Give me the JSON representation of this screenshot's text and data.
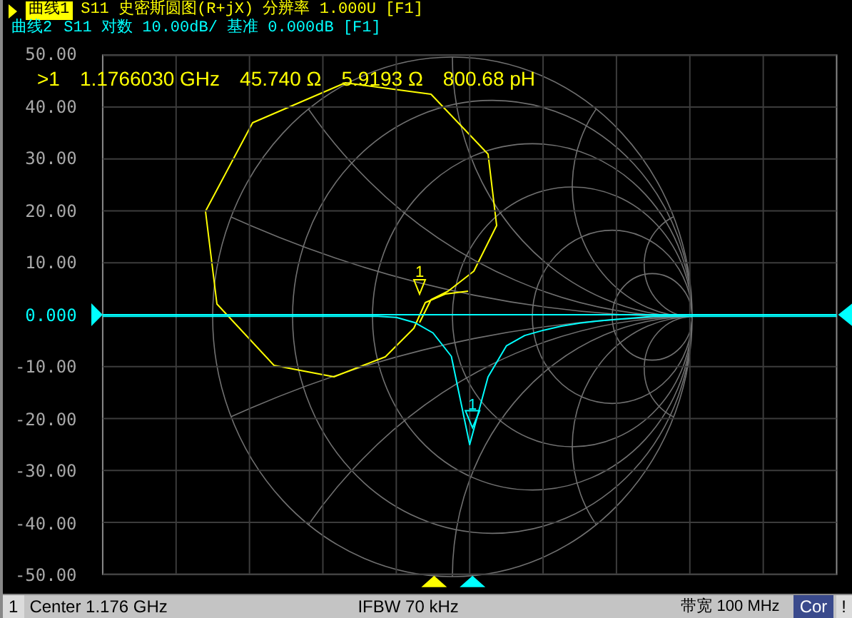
{
  "traces": [
    {
      "label": "曲线1",
      "selected": true,
      "color": "#ffff00",
      "text": "S11 史密斯圆图(R+jX) 分辨率 1.000U [F1]",
      "marker_label": "1"
    },
    {
      "label": "曲线2",
      "selected": false,
      "color": "#00ffff",
      "text": "S11 对数 10.00dB/ 基准 0.000dB [F1]",
      "marker_label": "1"
    }
  ],
  "marker_readout": [
    ">1",
    "1.1766030 GHz",
    "45.740 Ω",
    "5.9193 Ω",
    "800.68 pH"
  ],
  "plot": {
    "chart_data": {
      "type": "line",
      "ylim": [
        -50,
        50
      ],
      "grid": true,
      "yticks": [
        {
          "value": 50,
          "label": "50.00"
        },
        {
          "value": 40,
          "label": "40.00"
        },
        {
          "value": 30,
          "label": "30.00"
        },
        {
          "value": 20,
          "label": "20.00"
        },
        {
          "value": 10,
          "label": "10.00"
        },
        {
          "value": 0,
          "label": "0.000"
        },
        {
          "value": -10,
          "label": "-10.00"
        },
        {
          "value": -20,
          "label": "-20.00"
        },
        {
          "value": -30,
          "label": "-30.00"
        },
        {
          "value": -40,
          "label": "-40.00"
        },
        {
          "value": -50,
          "label": "-50.00"
        }
      ],
      "ref_lines": [
        {
          "axis": "y",
          "value": 0,
          "color": "#00ffff"
        }
      ],
      "series": [
        {
          "color": "#00ffff",
          "values": [
            -0.3,
            -0.3,
            -0.3,
            -0.3,
            -0.3,
            -0.3,
            -0.3,
            -0.3,
            -0.3,
            -0.3,
            -0.3,
            -0.3,
            -0.3,
            -0.3,
            -0.3,
            -0.3,
            -0.5,
            -1.5,
            -3.5,
            -8,
            -25,
            -12,
            -6,
            -4,
            -3,
            -2.2,
            -1.6,
            -1.2,
            -0.9,
            -0.6,
            -0.3,
            -0.3,
            -0.3,
            -0.3,
            -0.3,
            -0.3,
            -0.3,
            -0.3,
            -0.3,
            -0.3,
            -0.3
          ]
        }
      ]
    }
  },
  "status_bar": {
    "channel": "1",
    "center": "Center 1.176 GHz",
    "ifbw": "IFBW 70 kHz",
    "bandwidth": "带宽 100 MHz",
    "correction": "Cor",
    "warning": "!"
  }
}
